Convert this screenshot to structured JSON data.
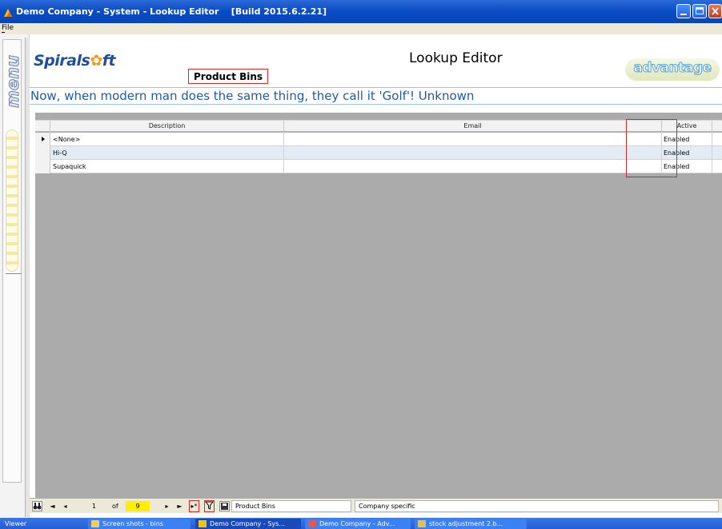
{
  "window": {
    "title": "Demo Company - System - Lookup Editor    [Build 2015.6.2.21]"
  },
  "menu": {
    "file": "File"
  },
  "sidebar": {
    "label": "menu"
  },
  "header": {
    "logo_part1": "Spirals",
    "logo_part2": "ft",
    "page_title": "Lookup Editor",
    "lookup_name": "Product Bins",
    "brand": "advantage"
  },
  "quote": "Now, when modern man does the same thing, they call it 'Golf'! Unknown",
  "grid": {
    "columns": [
      "Description",
      "Email",
      "Active"
    ],
    "rows": [
      {
        "description": "<None>",
        "email": "",
        "active": "Enabled"
      },
      {
        "description": "Hi-Q",
        "email": "",
        "active": "Enabled"
      },
      {
        "description": "Supaquick",
        "email": "",
        "active": "Enabled"
      }
    ]
  },
  "navigator": {
    "record": "1",
    "of_label": "of",
    "count": "9",
    "lookup_name": "Product Bins",
    "scope": "Company specific"
  },
  "taskbar": {
    "items": [
      "Viewer",
      "Screen shots - bins",
      "Demo Company - Sys...",
      "Demo Company - Adv...",
      "stock adjustment 2.b..."
    ]
  },
  "colors": {
    "titlebar": "#0a4bc4",
    "highlight_box": "#d62828",
    "quote_text": "#1e5aa8",
    "count_highlight": "#ffee00"
  }
}
